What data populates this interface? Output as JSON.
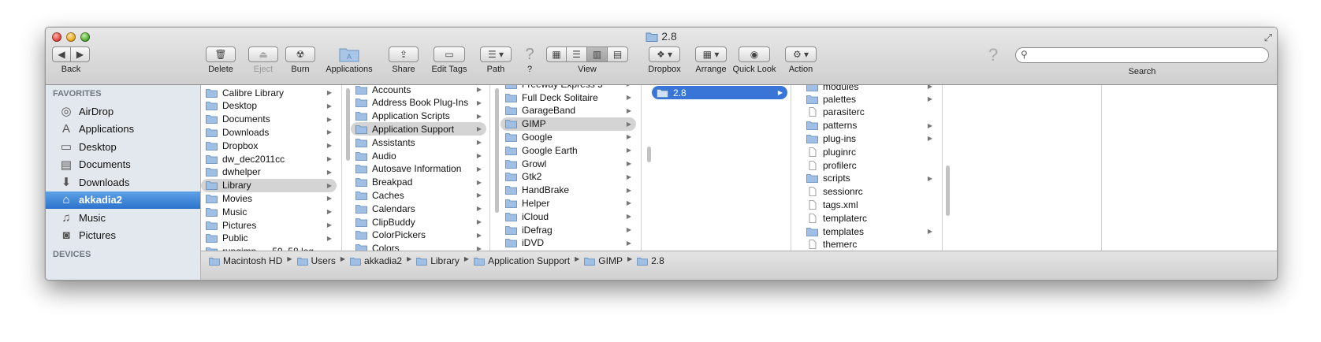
{
  "window": {
    "title": "2.8"
  },
  "toolbar": {
    "back_label": "Back",
    "delete_label": "Delete",
    "eject_label": "Eject",
    "burn_label": "Burn",
    "applications_label": "Applications",
    "share_label": "Share",
    "edit_tags_label": "Edit Tags",
    "path_label": "Path",
    "help_label": "?",
    "view_label": "View",
    "dropbox_label": "Dropbox",
    "arrange_label": "Arrange",
    "quicklook_label": "Quick Look",
    "action_label": "Action",
    "search_label": "Search"
  },
  "sidebar": {
    "favorites_heading": "FAVORITES",
    "devices_heading": "DEVICES",
    "items": [
      {
        "label": "AirDrop",
        "icon": "airdrop-icon"
      },
      {
        "label": "Applications",
        "icon": "applications-icon"
      },
      {
        "label": "Desktop",
        "icon": "desktop-icon"
      },
      {
        "label": "Documents",
        "icon": "documents-icon"
      },
      {
        "label": "Downloads",
        "icon": "downloads-icon"
      },
      {
        "label": "akkadia2",
        "icon": "home-icon",
        "selected": true
      },
      {
        "label": "Music",
        "icon": "music-icon"
      },
      {
        "label": "Pictures",
        "icon": "pictures-icon"
      }
    ]
  },
  "columns": {
    "col1": [
      "Calibre Library",
      "Desktop",
      "Documents",
      "Downloads",
      "Dropbox",
      "dw_dec2011cc",
      "dwhelper",
      "Library",
      "Movies",
      "Music",
      "Pictures",
      "Public"
    ],
    "col1_partial": "rungimp......59_58.log",
    "col2": [
      "Accounts",
      "Address Book Plug-Ins",
      "Application Scripts",
      "Application Support",
      "Assistants",
      "Audio",
      "Autosave Information",
      "Breakpad",
      "Caches",
      "Calendars",
      "ClipBuddy",
      "ColorPickers",
      "Colors"
    ],
    "col3_partial": "Freeway Express 5",
    "col3": [
      "Full Deck Solitaire",
      "GarageBand",
      "GIMP",
      "Google",
      "Google Earth",
      "Growl",
      "Gtk2",
      "HandBrake",
      "Helper",
      "iCloud",
      "iDefrag",
      "iDVD"
    ],
    "col4": [
      "2.8"
    ],
    "col5_partial": "modules",
    "col5": [
      {
        "name": "palettes",
        "type": "folder"
      },
      {
        "name": "parasiterc",
        "type": "file"
      },
      {
        "name": "patterns",
        "type": "folder"
      },
      {
        "name": "plug-ins",
        "type": "folder"
      },
      {
        "name": "pluginrc",
        "type": "file"
      },
      {
        "name": "profilerc",
        "type": "file"
      },
      {
        "name": "scripts",
        "type": "folder"
      },
      {
        "name": "sessionrc",
        "type": "file"
      },
      {
        "name": "tags.xml",
        "type": "file"
      },
      {
        "name": "templaterc",
        "type": "file"
      },
      {
        "name": "templates",
        "type": "folder"
      },
      {
        "name": "themerc",
        "type": "file"
      }
    ]
  },
  "pathbar": [
    "Macintosh HD",
    "Users",
    "akkadia2",
    "Library",
    "Application Support",
    "GIMP",
    "2.8"
  ],
  "colors": {
    "selection_blue": "#3875d7",
    "sidebar_bg": "#e3e8ee",
    "folder_blue": "#7fa7d0"
  }
}
